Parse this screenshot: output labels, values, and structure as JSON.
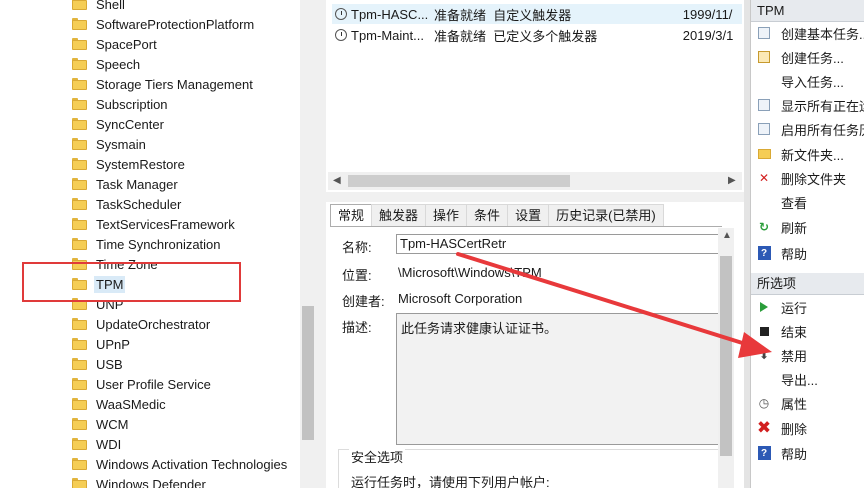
{
  "tree": {
    "items": [
      {
        "label": "Shell",
        "selected": false
      },
      {
        "label": "SoftwareProtectionPlatform",
        "selected": false
      },
      {
        "label": "SpacePort",
        "selected": false
      },
      {
        "label": "Speech",
        "selected": false
      },
      {
        "label": "Storage Tiers Management",
        "selected": false
      },
      {
        "label": "Subscription",
        "selected": false
      },
      {
        "label": "SyncCenter",
        "selected": false
      },
      {
        "label": "Sysmain",
        "selected": false
      },
      {
        "label": "SystemRestore",
        "selected": false
      },
      {
        "label": "Task Manager",
        "selected": false
      },
      {
        "label": "TaskScheduler",
        "selected": false
      },
      {
        "label": "TextServicesFramework",
        "selected": false
      },
      {
        "label": "Time Synchronization",
        "selected": false
      },
      {
        "label": "Time Zone",
        "selected": false
      },
      {
        "label": "TPM",
        "selected": true
      },
      {
        "label": "UNP",
        "selected": false
      },
      {
        "label": "UpdateOrchestrator",
        "selected": false
      },
      {
        "label": "UPnP",
        "selected": false
      },
      {
        "label": "USB",
        "selected": false
      },
      {
        "label": "User Profile Service",
        "selected": false
      },
      {
        "label": "WaaSMedic",
        "selected": false
      },
      {
        "label": "WCM",
        "selected": false
      },
      {
        "label": "WDI",
        "selected": false
      },
      {
        "label": "Windows Activation Technologies",
        "selected": false
      },
      {
        "label": "Windows Defender",
        "selected": false
      }
    ]
  },
  "tasks": {
    "rows": [
      {
        "name": "Tpm-HASC...",
        "status": "准备就绪",
        "trigger": "自定义触发器",
        "time": "1999/11/"
      },
      {
        "name": "Tpm-Maint...",
        "status": "准备就绪",
        "trigger": "已定义多个触发器",
        "time": "2019/3/1"
      }
    ]
  },
  "detail": {
    "tabs": [
      "常规",
      "触发器",
      "操作",
      "条件",
      "设置",
      "历史记录(已禁用)"
    ],
    "active_tab": "常规",
    "name_label": "名称:",
    "name_value": "Tpm-HASCertRetr",
    "location_label": "位置:",
    "location_value": "\\Microsoft\\Windows\\TPM",
    "author_label": "创建者:",
    "author_value": "Microsoft Corporation",
    "desc_label": "描述:",
    "desc_value": "此任务请求健康认证证书。",
    "security_title": "安全选项",
    "security_text": "运行任务时，请使用下列用户帐户:"
  },
  "actions": {
    "header_tpm": "TPM",
    "tpm_items": [
      {
        "label": "创建基本任务...",
        "icon": "create-basic-task-icon"
      },
      {
        "label": "创建任务...",
        "icon": "create-task-icon"
      },
      {
        "label": "导入任务...",
        "icon": "none"
      },
      {
        "label": "显示所有正在运",
        "icon": "running-tasks-icon"
      },
      {
        "label": "启用所有任务历",
        "icon": "history-icon"
      },
      {
        "label": "新文件夹...",
        "icon": "new-folder-icon"
      },
      {
        "label": "删除文件夹",
        "icon": "delete-folder-icon"
      },
      {
        "label": "查看",
        "icon": "none"
      },
      {
        "label": "刷新",
        "icon": "refresh-icon"
      },
      {
        "label": "帮助",
        "icon": "help-icon"
      }
    ],
    "header_selected": "所选项",
    "selected_items": [
      {
        "label": "运行",
        "icon": "run-icon"
      },
      {
        "label": "结束",
        "icon": "end-icon"
      },
      {
        "label": "禁用",
        "icon": "disable-icon"
      },
      {
        "label": "导出...",
        "icon": "none"
      },
      {
        "label": "属性",
        "icon": "properties-icon"
      },
      {
        "label": "删除",
        "icon": "delete-icon"
      },
      {
        "label": "帮助",
        "icon": "help-icon"
      }
    ]
  },
  "colors": {
    "highlight": "#e03a3a",
    "selection": "#d9eaf7",
    "help_blue": "#2c59b5",
    "run_green": "#2a9d3a"
  }
}
